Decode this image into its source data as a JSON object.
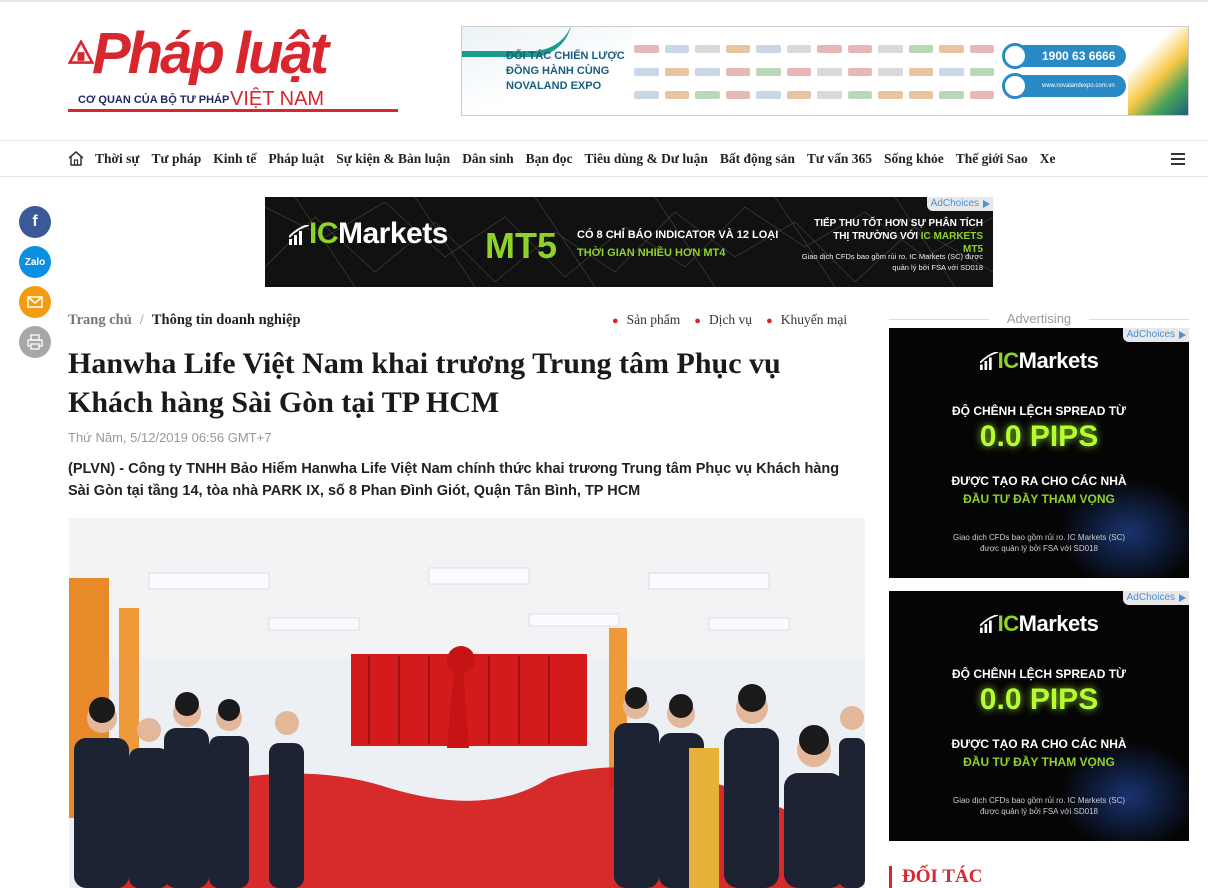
{
  "logo": {
    "main": "Pháp luật",
    "sub": "CƠ QUAN CỦA BỘ TƯ PHÁP",
    "country": "VIỆT NAM"
  },
  "top_banner": {
    "line1": "ĐỐI TÁC CHIẾN LƯỢC",
    "line2": "ĐỒNG HÀNH CÙNG",
    "line3": "NOVALAND EXPO",
    "hotline": "1900 63 6666",
    "website": "www.novalandexpo.com.vn"
  },
  "nav": {
    "home_icon": "home-icon",
    "items": [
      "Thời sự",
      "Tư pháp",
      "Kinh tế",
      "Pháp luật",
      "Sự kiện & Bàn luận",
      "Dân sinh",
      "Bạn đọc",
      "Tiêu dùng & Dư luận",
      "Bất động sản",
      "Tư vấn 365",
      "Sống khỏe",
      "Thế giới Sao",
      "Xe"
    ],
    "menu_icon": "hamburger-menu-icon"
  },
  "social": {
    "facebook": "f",
    "zalo": "Zalo",
    "mail_icon": "mail-icon",
    "print_icon": "print-icon"
  },
  "mid_ad": {
    "adchoices": "AdChoices",
    "brand_ic": "IC",
    "brand_rest": "Markets",
    "product": "MT5",
    "line1": "CÓ 8 CHỈ BÁO INDICATOR VÀ 12 LOẠI",
    "line2": "THỜI GIAN NHIỀU HƠN MT4",
    "right1": "TIẾP THU TỐT HƠN SỰ PHÂN TÍCH",
    "right2a": "THỊ TRƯỜNG VỚI ",
    "right2b": "IC MARKETS MT5",
    "right3": "Giao dịch CFDs bao gồm rủi ro. IC Markets (SC) được quản lý bởi FSA với SD018"
  },
  "breadcrumb": {
    "home": "Trang chủ",
    "sep": "/",
    "current": "Thông tin doanh nghiệp"
  },
  "tags": [
    "Sản phẩm",
    "Dịch vụ",
    "Khuyến mại"
  ],
  "article": {
    "title": "Hanwha Life Việt Nam khai trương Trung tâm Phục vụ Khách hàng Sài Gòn tại TP HCM",
    "date": "Thứ Năm, 5/12/2019 06:56 GMT+7",
    "sapo": "(PLVN) - Công ty TNHH Bảo Hiểm Hanwha Life Việt Nam chính thức khai trương Trung tâm Phục vụ Khách hàng Sài Gòn tại tầng 14, tòa nhà PARK IX, số 8 Phan Đình Giót, Quận Tân Bình, TP HCM"
  },
  "sidebar": {
    "advertising_label": "Advertising",
    "ads": [
      {
        "adchoices": "AdChoices",
        "brand_ic": "IC",
        "brand_rest": "Markets",
        "t1": "ĐỘ CHÊNH LỆCH SPREAD TỪ",
        "pips": "0.0 PIPS",
        "t2": "ĐƯỢC TẠO RA CHO CÁC NHÀ",
        "t3": "ĐẦU TƯ ĐẦY THAM VỌNG",
        "t4": "Giao dịch CFDs bao gồm rủi ro. IC Markets (SC) được quản lý bởi FSA với SD018"
      },
      {
        "adchoices": "AdChoices",
        "brand_ic": "IC",
        "brand_rest": "Markets",
        "t1": "ĐỘ CHÊNH LỆCH SPREAD TỪ",
        "pips": "0.0 PIPS",
        "t2": "ĐƯỢC TẠO RA CHO CÁC NHÀ",
        "t3": "ĐẦU TƯ ĐẦY THAM VỌNG",
        "t4": "Giao dịch CFDs bao gồm rủi ro. IC Markets (SC) được quản lý bởi FSA với SD018"
      }
    ],
    "partner_heading": "ĐỐI TÁC"
  },
  "colors": {
    "brand_red": "#d7262e",
    "ic_green": "#8fd22a",
    "facebook": "#3b5998",
    "zalo": "#0a8fe3",
    "mail": "#f39c12",
    "print": "#a7a7a7"
  }
}
